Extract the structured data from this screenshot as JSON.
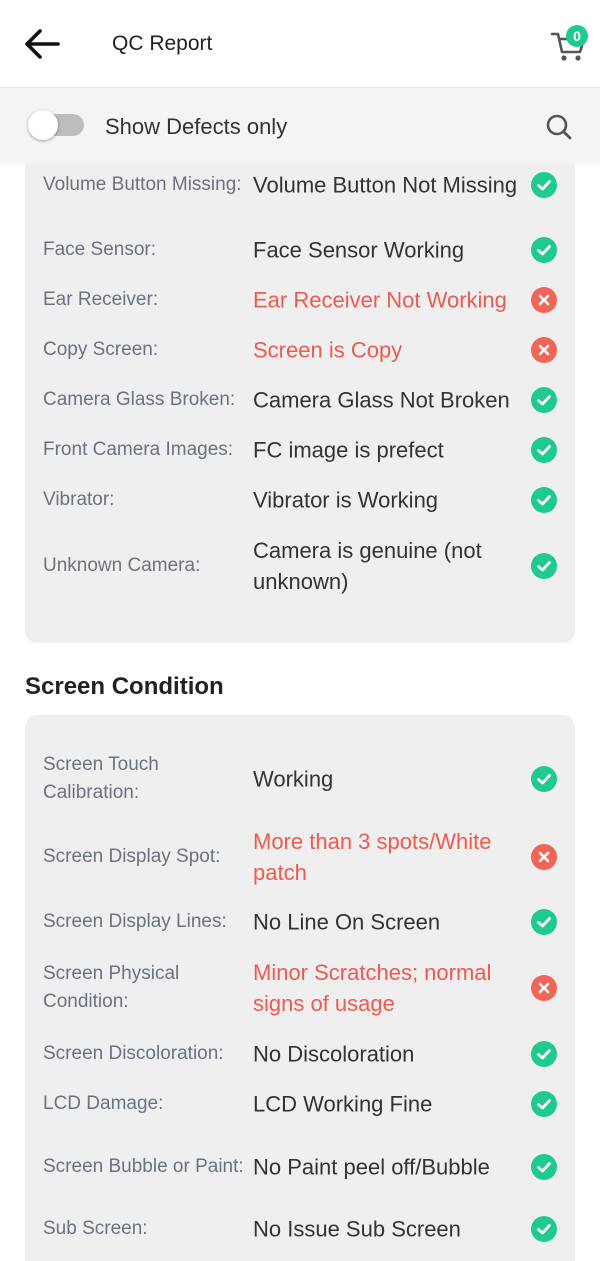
{
  "header": {
    "title": "QC Report",
    "cart_count": "0"
  },
  "filter": {
    "label": "Show Defects only",
    "enabled": false
  },
  "section_1": {
    "rows": [
      {
        "label": "Volume Button Missing:",
        "value": "Volume Button Not Missing",
        "status": "ok"
      },
      {
        "label": "Face Sensor:",
        "value": "Face Sensor Working",
        "status": "ok"
      },
      {
        "label": "Ear Receiver:",
        "value": "Ear Receiver Not Working",
        "status": "bad"
      },
      {
        "label": "Copy Screen:",
        "value": "Screen is Copy",
        "status": "bad"
      },
      {
        "label": "Camera Glass Broken:",
        "value": "Camera Glass Not Broken",
        "status": "ok"
      },
      {
        "label": "Front Camera Images:",
        "value": "FC image is prefect",
        "status": "ok"
      },
      {
        "label": "Vibrator:",
        "value": "Vibrator is Working",
        "status": "ok"
      },
      {
        "label": "Unknown Camera:",
        "value": "Camera is genuine (not unknown)",
        "status": "ok"
      }
    ]
  },
  "section_2": {
    "title": "Screen Condition",
    "rows": [
      {
        "label": "Screen Touch Calibration:",
        "value": "Working",
        "status": "ok"
      },
      {
        "label": "Screen Display Spot:",
        "value": "More than 3 spots/White patch",
        "status": "bad"
      },
      {
        "label": "Screen Display Lines:",
        "value": "No Line On Screen",
        "status": "ok"
      },
      {
        "label": "Screen Physical Condition:",
        "value": "Minor Scratches; normal signs of usage",
        "status": "bad"
      },
      {
        "label": "Screen Discoloration:",
        "value": "No Discoloration",
        "status": "ok"
      },
      {
        "label": "LCD Damage:",
        "value": "LCD Working Fine",
        "status": "ok"
      },
      {
        "label": "Screen Bubble or Paint:",
        "value": "No Paint peel off/Bubble",
        "status": "ok"
      },
      {
        "label": "Sub Screen:",
        "value": "No Issue Sub Screen",
        "status": "ok"
      }
    ]
  },
  "colors": {
    "ok": "#1ecb8d",
    "bad": "#f16458",
    "bad_text": "#ef5a50"
  }
}
